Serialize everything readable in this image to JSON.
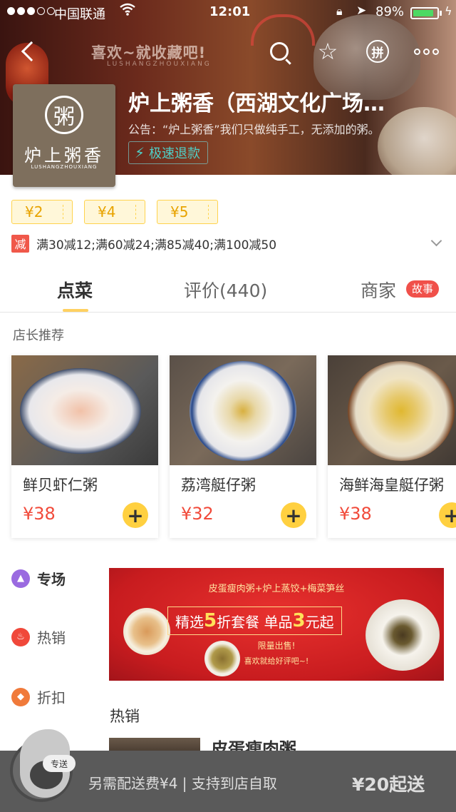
{
  "status_bar": {
    "carrier": "中国联通",
    "time": "12:01",
    "battery": "89%"
  },
  "header": {
    "slogan": "喜欢~就收藏吧!",
    "slogan_sub": "LUSHANGZHOUXIANG",
    "pin_label": "拼"
  },
  "shop": {
    "logo_seal": "粥",
    "logo_name": "炉上粥香",
    "logo_pinyin": "LUSHANGZHOUXIANG",
    "title": "炉上粥香（西湖文化广场…",
    "notice": "公告：“炉上粥香”我们只做纯手工，无添加的粥。",
    "fast_refund": "极速退款"
  },
  "coupons": [
    "¥2",
    "¥4",
    "¥5"
  ],
  "promotion": {
    "tag": "减",
    "text": "满30减12;满60减24;满85减40;满100减50"
  },
  "tabs": {
    "order": "点菜",
    "reviews": "评价(440)",
    "merchant": "商家",
    "story_badge": "故事"
  },
  "recommend": {
    "title": "店长推荐",
    "items": [
      {
        "name": "鲜贝虾仁粥",
        "price": "¥38",
        "add": "+"
      },
      {
        "name": "荔湾艇仔粥",
        "price": "¥32",
        "add": "+"
      },
      {
        "name": "海鲜海皇艇仔粥",
        "price": "¥38",
        "add": "+"
      }
    ]
  },
  "side_menu": [
    {
      "label": "专场"
    },
    {
      "label": "热销"
    },
    {
      "label": "折扣"
    }
  ],
  "ad_banner": {
    "line1": "皮蛋瘦肉粥+炉上蒸饺+梅菜笋丝",
    "line2_a": "精选",
    "line2_b": "5",
    "line2_c": "折套餐 单品",
    "line2_d": "3",
    "line2_e": "元起",
    "line3": "限量出售!",
    "line4": "喜欢就给好评吧~!"
  },
  "hot": {
    "title": "热销",
    "first_dish": "皮蛋瘦肉粥"
  },
  "bottom_bar": {
    "mascot_label": "专送",
    "fee_text": "另需配送费¥4 | 支持到店自取",
    "min_order": "¥20起送"
  },
  "colors": {
    "accent_yellow": "#ffd040",
    "price_red": "#f14a3a",
    "teal": "#4fd0c8"
  }
}
